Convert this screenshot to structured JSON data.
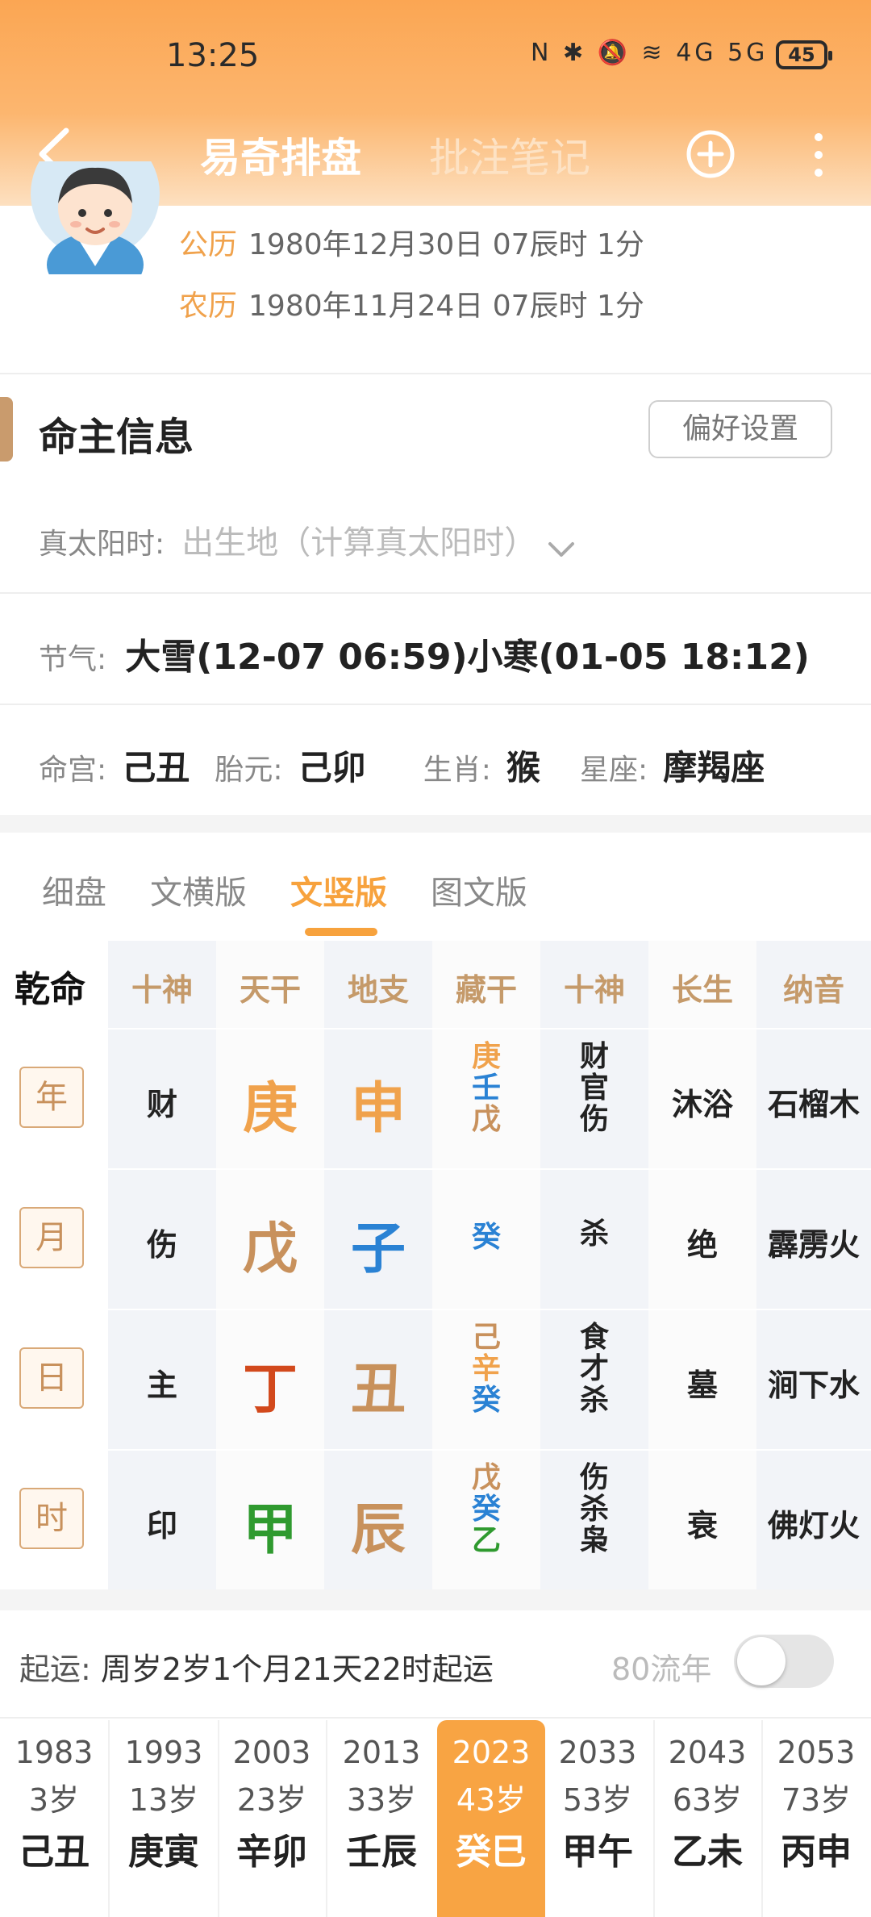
{
  "status_bar": {
    "time": "13:25",
    "icons": "N ✱ 🔕 ≋ 4G 5G",
    "battery": "45"
  },
  "nav": {
    "tab_active": "易奇排盘",
    "tab_inactive": "批注笔记"
  },
  "profile": {
    "solar_label": "公历",
    "solar_value": "1980年12月30日 07辰时 1分",
    "lunar_label": "农历",
    "lunar_value": "1980年11月24日 07辰时 1分"
  },
  "info": {
    "title": "命主信息",
    "pref_button": "偏好设置",
    "solar_time_label": "真太阳时:",
    "solar_time_placeholder": "出生地（计算真太阳时）",
    "jieqi_label": "节气:",
    "jieqi_value": "大雪(12-07 06:59)小寒(01-05 18:12)",
    "minggong_label": "命宫:",
    "minggong_value": "己丑",
    "taiyuan_label": "胎元:",
    "taiyuan_value": "己卯",
    "shengxiao_label": "生肖:",
    "shengxiao_value": "猴",
    "xingzuo_label": "星座:",
    "xingzuo_value": "摩羯座"
  },
  "subtabs": [
    "细盘",
    "文横版",
    "文竖版",
    "图文版"
  ],
  "chart": {
    "qianming": "乾命",
    "headers": [
      "十神",
      "天干",
      "地支",
      "藏干",
      "十神",
      "长生",
      "纳音"
    ],
    "rows": [
      {
        "pillar": "年",
        "shishen": "财",
        "gan": "庚",
        "zhi": "申",
        "canggan": [
          "庚",
          "壬",
          "戊"
        ],
        "shishen2": [
          "财",
          "官",
          "伤"
        ],
        "changsheng": "沐浴",
        "nayin": "石榴木"
      },
      {
        "pillar": "月",
        "shishen": "伤",
        "gan": "戊",
        "zhi": "子",
        "canggan": [
          "癸"
        ],
        "shishen2": [
          "杀"
        ],
        "changsheng": "绝",
        "nayin": "霹雳火"
      },
      {
        "pillar": "日",
        "shishen": "主",
        "gan": "丁",
        "zhi": "丑",
        "canggan": [
          "己",
          "辛",
          "癸"
        ],
        "shishen2": [
          "食",
          "才",
          "杀"
        ],
        "changsheng": "墓",
        "nayin": "涧下水"
      },
      {
        "pillar": "时",
        "shishen": "印",
        "gan": "甲",
        "zhi": "辰",
        "canggan": [
          "戊",
          "癸",
          "乙"
        ],
        "shishen2": [
          "伤",
          "杀",
          "枭"
        ],
        "changsheng": "衰",
        "nayin": "佛灯火"
      }
    ],
    "colors": {
      "metal": "#f0a24c",
      "water": "#2a82d4",
      "earth": "#c8915c",
      "fire": "#d2491c",
      "wood": "#2f9a2f"
    }
  },
  "luck": {
    "qiyun_label": "起运:",
    "qiyun_value": "周岁2岁1个月21天22时起运",
    "liunian_label": "80流年",
    "dayun": [
      {
        "year": "1983",
        "age": "3岁",
        "ganzhi": "己丑"
      },
      {
        "year": "1993",
        "age": "13岁",
        "ganzhi": "庚寅"
      },
      {
        "year": "2003",
        "age": "23岁",
        "ganzhi": "辛卯"
      },
      {
        "year": "2013",
        "age": "33岁",
        "ganzhi": "壬辰"
      },
      {
        "year": "2023",
        "age": "43岁",
        "ganzhi": "癸巳"
      },
      {
        "year": "2033",
        "age": "53岁",
        "ganzhi": "甲午"
      },
      {
        "year": "2043",
        "age": "63岁",
        "ganzhi": "乙未"
      },
      {
        "year": "2053",
        "age": "73岁",
        "ganzhi": "丙申"
      }
    ]
  }
}
